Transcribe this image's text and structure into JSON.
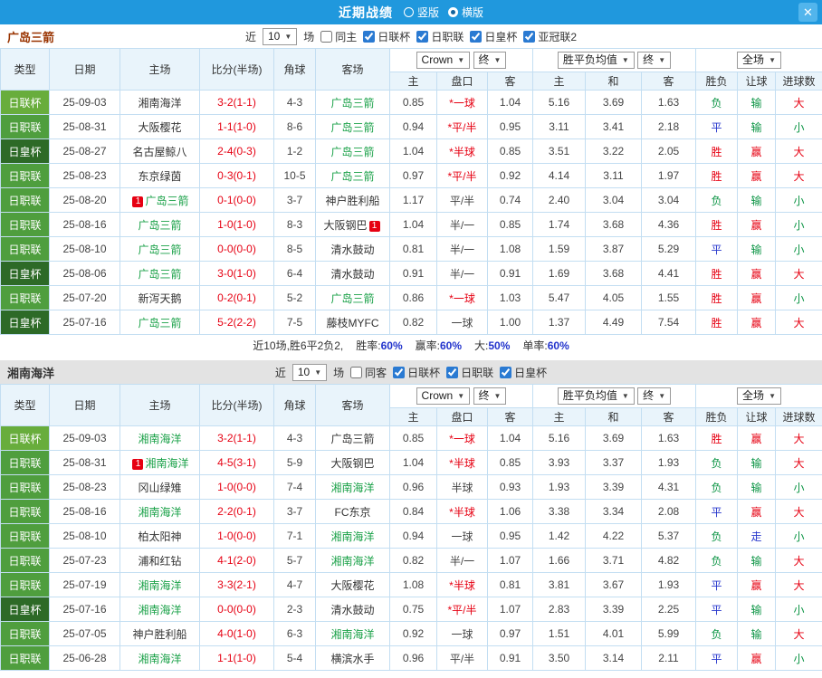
{
  "titlebar": {
    "title": "近期战绩",
    "layout_options": [
      {
        "label": "竖版",
        "checked": false
      },
      {
        "label": "横版",
        "checked": true
      }
    ],
    "close_label": "✕"
  },
  "filter_labels": {
    "recent_prefix": "近",
    "recent_count": "10",
    "recent_suffix": "场"
  },
  "table_headers": {
    "type": "类型",
    "date": "日期",
    "home": "主场",
    "score": "比分(半场)",
    "corner": "角球",
    "away": "客场",
    "asian_sub": [
      "主",
      "盘口",
      "客"
    ],
    "euro_sub": [
      "主",
      "和",
      "客"
    ],
    "result_sub": [
      "胜负",
      "让球",
      "进球数"
    ],
    "selects": {
      "bookmaker": "Crown",
      "final1": "终",
      "odds_avg": "胜平负均值",
      "final2": "终",
      "scope": "全场"
    }
  },
  "colors": {
    "titlebar_bg": "#2098dd",
    "header_bg": "#e9f4fb",
    "table_border": "#c3def2",
    "team_highlight": "#1aa148",
    "score": "#e60012",
    "badge_bg": "#e60012",
    "handicap_star": "#e60012",
    "stat_value": "#2233cc",
    "result_map": {
      "胜": "#e60012",
      "平": "#2636cc",
      "负": "#0b9444",
      "赢": "#e60012",
      "输": "#0b9444",
      "走": "#2636cc",
      "大": "#e60012",
      "小": "#0b9444"
    },
    "league_map": {
      "日联杯": "#68ad3c",
      "日职联": "#4f9e3e",
      "日皇杯": "#2d6a27"
    }
  },
  "sections": [
    {
      "team": "广岛三箭",
      "title_color": "#993300",
      "same_side": {
        "label": "同主",
        "checked": false
      },
      "competitions": [
        {
          "label": "日联杯",
          "checked": true
        },
        {
          "label": "日职联",
          "checked": true
        },
        {
          "label": "日皇杯",
          "checked": true
        },
        {
          "label": "亚冠联2",
          "checked": true
        }
      ],
      "rows": [
        {
          "type": "日联杯",
          "date": "25-09-03",
          "home": "湘南海洋",
          "home_badge": "",
          "score": "3-2(1-1)",
          "corner": "4-3",
          "away": "广岛三箭",
          "away_badge": "",
          "asian": [
            "0.85",
            "*一球",
            "1.04"
          ],
          "euro": [
            "5.16",
            "3.69",
            "1.63"
          ],
          "result": [
            "负",
            "输",
            "大"
          ]
        },
        {
          "type": "日职联",
          "date": "25-08-31",
          "home": "大阪樱花",
          "home_badge": "",
          "score": "1-1(1-0)",
          "corner": "8-6",
          "away": "广岛三箭",
          "away_badge": "",
          "asian": [
            "0.94",
            "*平/半",
            "0.95"
          ],
          "euro": [
            "3.11",
            "3.41",
            "2.18"
          ],
          "result": [
            "平",
            "输",
            "小"
          ]
        },
        {
          "type": "日皇杯",
          "date": "25-08-27",
          "home": "名古屋鲸八",
          "home_badge": "",
          "score": "2-4(0-3)",
          "corner": "1-2",
          "away": "广岛三箭",
          "away_badge": "",
          "asian": [
            "1.04",
            "*半球",
            "0.85"
          ],
          "euro": [
            "3.51",
            "3.22",
            "2.05"
          ],
          "result": [
            "胜",
            "赢",
            "大"
          ]
        },
        {
          "type": "日职联",
          "date": "25-08-23",
          "home": "东京绿茵",
          "home_badge": "",
          "score": "0-3(0-1)",
          "corner": "10-5",
          "away": "广岛三箭",
          "away_badge": "",
          "asian": [
            "0.97",
            "*平/半",
            "0.92"
          ],
          "euro": [
            "4.14",
            "3.11",
            "1.97"
          ],
          "result": [
            "胜",
            "赢",
            "大"
          ]
        },
        {
          "type": "日职联",
          "date": "25-08-20",
          "home": "广岛三箭",
          "home_badge": "1",
          "score": "0-1(0-0)",
          "corner": "3-7",
          "away": "神户胜利船",
          "away_badge": "",
          "asian": [
            "1.17",
            "平/半",
            "0.74"
          ],
          "euro": [
            "2.40",
            "3.04",
            "3.04"
          ],
          "result": [
            "负",
            "输",
            "小"
          ]
        },
        {
          "type": "日职联",
          "date": "25-08-16",
          "home": "广岛三箭",
          "home_badge": "",
          "score": "1-0(1-0)",
          "corner": "8-3",
          "away": "大阪钢巴",
          "away_badge": "1",
          "asian": [
            "1.04",
            "半/一",
            "0.85"
          ],
          "euro": [
            "1.74",
            "3.68",
            "4.36"
          ],
          "result": [
            "胜",
            "赢",
            "小"
          ]
        },
        {
          "type": "日职联",
          "date": "25-08-10",
          "home": "广岛三箭",
          "home_badge": "",
          "score": "0-0(0-0)",
          "corner": "8-5",
          "away": "清水鼓动",
          "away_badge": "",
          "asian": [
            "0.81",
            "半/一",
            "1.08"
          ],
          "euro": [
            "1.59",
            "3.87",
            "5.29"
          ],
          "result": [
            "平",
            "输",
            "小"
          ]
        },
        {
          "type": "日皇杯",
          "date": "25-08-06",
          "home": "广岛三箭",
          "home_badge": "",
          "score": "3-0(1-0)",
          "corner": "6-4",
          "away": "清水鼓动",
          "away_badge": "",
          "asian": [
            "0.91",
            "半/一",
            "0.91"
          ],
          "euro": [
            "1.69",
            "3.68",
            "4.41"
          ],
          "result": [
            "胜",
            "赢",
            "大"
          ]
        },
        {
          "type": "日职联",
          "date": "25-07-20",
          "home": "新泻天鹅",
          "home_badge": "",
          "score": "0-2(0-1)",
          "corner": "5-2",
          "away": "广岛三箭",
          "away_badge": "",
          "asian": [
            "0.86",
            "*一球",
            "1.03"
          ],
          "euro": [
            "5.47",
            "4.05",
            "1.55"
          ],
          "result": [
            "胜",
            "赢",
            "小"
          ]
        },
        {
          "type": "日皇杯",
          "date": "25-07-16",
          "home": "广岛三箭",
          "home_badge": "",
          "score": "5-2(2-2)",
          "corner": "7-5",
          "away": "藤枝MYFC",
          "away_badge": "",
          "asian": [
            "0.82",
            "一球",
            "1.00"
          ],
          "euro": [
            "1.37",
            "4.49",
            "7.54"
          ],
          "result": [
            "胜",
            "赢",
            "大"
          ]
        }
      ],
      "footer": {
        "summary": "近10场,胜6平2负2,",
        "stats": [
          {
            "label": "胜率:",
            "value": "60%"
          },
          {
            "label": "赢率:",
            "value": "60%"
          },
          {
            "label": "大:",
            "value": "50%"
          },
          {
            "label": "单率:",
            "value": "60%"
          }
        ]
      }
    },
    {
      "team": "湘南海洋",
      "title_color": "#333333",
      "same_side": {
        "label": "同客",
        "checked": false
      },
      "competitions": [
        {
          "label": "日联杯",
          "checked": true
        },
        {
          "label": "日职联",
          "checked": true
        },
        {
          "label": "日皇杯",
          "checked": true
        }
      ],
      "rows": [
        {
          "type": "日联杯",
          "date": "25-09-03",
          "home": "湘南海洋",
          "home_badge": "",
          "score": "3-2(1-1)",
          "corner": "4-3",
          "away": "广岛三箭",
          "away_badge": "",
          "asian": [
            "0.85",
            "*一球",
            "1.04"
          ],
          "euro": [
            "5.16",
            "3.69",
            "1.63"
          ],
          "result": [
            "胜",
            "赢",
            "大"
          ]
        },
        {
          "type": "日职联",
          "date": "25-08-31",
          "home": "湘南海洋",
          "home_badge": "1",
          "score": "4-5(3-1)",
          "corner": "5-9",
          "away": "大阪钢巴",
          "away_badge": "",
          "asian": [
            "1.04",
            "*半球",
            "0.85"
          ],
          "euro": [
            "3.93",
            "3.37",
            "1.93"
          ],
          "result": [
            "负",
            "输",
            "大"
          ]
        },
        {
          "type": "日职联",
          "date": "25-08-23",
          "home": "冈山绿雉",
          "home_badge": "",
          "score": "1-0(0-0)",
          "corner": "7-4",
          "away": "湘南海洋",
          "away_badge": "",
          "asian": [
            "0.96",
            "半球",
            "0.93"
          ],
          "euro": [
            "1.93",
            "3.39",
            "4.31"
          ],
          "result": [
            "负",
            "输",
            "小"
          ]
        },
        {
          "type": "日职联",
          "date": "25-08-16",
          "home": "湘南海洋",
          "home_badge": "",
          "score": "2-2(0-1)",
          "corner": "3-7",
          "away": "FC东京",
          "away_badge": "",
          "asian": [
            "0.84",
            "*半球",
            "1.06"
          ],
          "euro": [
            "3.38",
            "3.34",
            "2.08"
          ],
          "result": [
            "平",
            "赢",
            "大"
          ]
        },
        {
          "type": "日职联",
          "date": "25-08-10",
          "home": "柏太阳神",
          "home_badge": "",
          "score": "1-0(0-0)",
          "corner": "7-1",
          "away": "湘南海洋",
          "away_badge": "",
          "asian": [
            "0.94",
            "一球",
            "0.95"
          ],
          "euro": [
            "1.42",
            "4.22",
            "5.37"
          ],
          "result": [
            "负",
            "走",
            "小"
          ]
        },
        {
          "type": "日职联",
          "date": "25-07-23",
          "home": "浦和红钻",
          "home_badge": "",
          "score": "4-1(2-0)",
          "corner": "5-7",
          "away": "湘南海洋",
          "away_badge": "",
          "asian": [
            "0.82",
            "半/一",
            "1.07"
          ],
          "euro": [
            "1.66",
            "3.71",
            "4.82"
          ],
          "result": [
            "负",
            "输",
            "大"
          ]
        },
        {
          "type": "日职联",
          "date": "25-07-19",
          "home": "湘南海洋",
          "home_badge": "",
          "score": "3-3(2-1)",
          "corner": "4-7",
          "away": "大阪樱花",
          "away_badge": "",
          "asian": [
            "1.08",
            "*半球",
            "0.81"
          ],
          "euro": [
            "3.81",
            "3.67",
            "1.93"
          ],
          "result": [
            "平",
            "赢",
            "大"
          ]
        },
        {
          "type": "日皇杯",
          "date": "25-07-16",
          "home": "湘南海洋",
          "home_badge": "",
          "score": "0-0(0-0)",
          "corner": "2-3",
          "away": "清水鼓动",
          "away_badge": "",
          "asian": [
            "0.75",
            "*平/半",
            "1.07"
          ],
          "euro": [
            "2.83",
            "3.39",
            "2.25"
          ],
          "result": [
            "平",
            "输",
            "小"
          ]
        },
        {
          "type": "日职联",
          "date": "25-07-05",
          "home": "神户胜利船",
          "home_badge": "",
          "score": "4-0(1-0)",
          "corner": "6-3",
          "away": "湘南海洋",
          "away_badge": "",
          "asian": [
            "0.92",
            "一球",
            "0.97"
          ],
          "euro": [
            "1.51",
            "4.01",
            "5.99"
          ],
          "result": [
            "负",
            "输",
            "大"
          ]
        },
        {
          "type": "日职联",
          "date": "25-06-28",
          "home": "湘南海洋",
          "home_badge": "",
          "score": "1-1(1-0)",
          "corner": "5-4",
          "away": "横滨水手",
          "away_badge": "",
          "asian": [
            "0.96",
            "平/半",
            "0.91"
          ],
          "euro": [
            "3.50",
            "3.14",
            "2.11"
          ],
          "result": [
            "平",
            "赢",
            "小"
          ]
        }
      ]
    }
  ]
}
